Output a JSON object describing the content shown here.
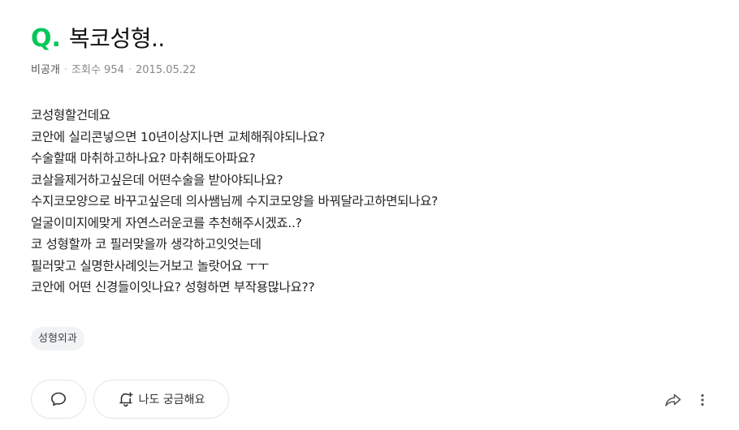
{
  "question": {
    "q_letter": "Q",
    "q_dot": ".",
    "title": "복코성형..",
    "author": "비공개",
    "separator": "·",
    "views_label": "조회수 954",
    "date": "2015.05.22",
    "body_lines": [
      "코성형할건데요",
      "코안에 실리콘넣으면 10년이상지나면 교체해줘야되나요?",
      "수술할때 마취하고하나요? 마취해도아파요?",
      "코살을제거하고싶은데 어떤수술을 받아야되나요?",
      "수지코모양으로 바꾸고싶은데 의사쌤님께 수지코모양을 바꿔달라고하면되나요?",
      "얼굴이미지에맞게 자연스러운코를 추천해주시겠죠..?",
      "코 성형할까 코 필러맞을까 생각하고잇엇는데",
      "필러맞고 실명한사례잇는거보고 놀랏어요 ㅜㅜ",
      "코안에 어떤 신경들이잇나요? 성형하면 부작용많나요??"
    ],
    "tag": "성형외과"
  },
  "actions": {
    "curious_label": "나도 궁금해요"
  },
  "icons": {
    "comment": "comment-icon",
    "curious": "curious-bell-icon",
    "share": "share-icon",
    "more": "more-vertical-icon"
  },
  "colors": {
    "accent": "#03c75a",
    "meta_text": "#888888",
    "tag_background": "#f2f3f5"
  }
}
